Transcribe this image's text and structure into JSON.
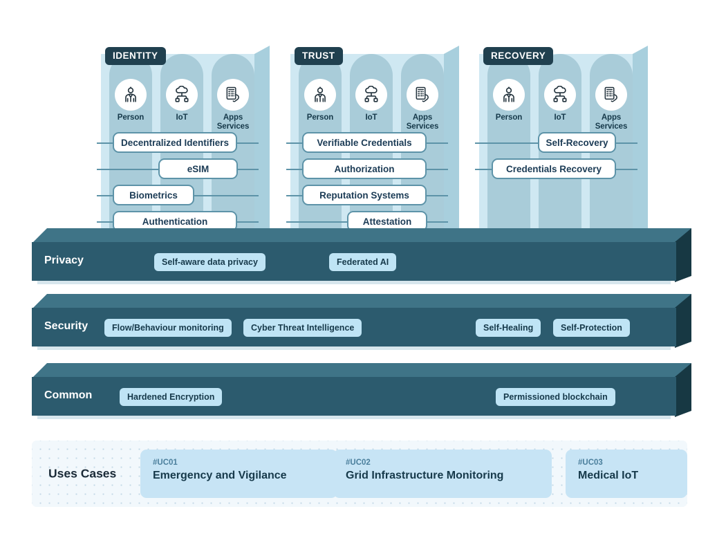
{
  "diagram": {
    "pillars": [
      {
        "title": "IDENTITY",
        "actors": [
          {
            "icon": "person-icon",
            "label": "Person"
          },
          {
            "icon": "iot-cloud-icon",
            "label": "IoT"
          },
          {
            "icon": "apps-services-icon",
            "label": "Apps\nServices"
          }
        ],
        "capabilities": [
          "Decentralized Identifiers",
          "eSIM",
          "Biometrics",
          "Authentication"
        ]
      },
      {
        "title": "TRUST",
        "actors": [
          {
            "icon": "person-icon",
            "label": "Person"
          },
          {
            "icon": "iot-cloud-icon",
            "label": "IoT"
          },
          {
            "icon": "apps-services-icon",
            "label": "Apps\nServices"
          }
        ],
        "capabilities": [
          "Verifiable Credentials",
          "Authorization",
          "Reputation Systems",
          "Attestation"
        ]
      },
      {
        "title": "RECOVERY",
        "actors": [
          {
            "icon": "person-icon",
            "label": "Person"
          },
          {
            "icon": "iot-cloud-icon",
            "label": "IoT"
          },
          {
            "icon": "apps-services-icon",
            "label": "Apps\nServices"
          }
        ],
        "capabilities": [
          "Self-Recovery",
          "Credentials Recovery"
        ]
      }
    ],
    "layers": [
      {
        "label": "Privacy",
        "tags": [
          "Self-aware data privacy",
          "Federated AI"
        ]
      },
      {
        "label": "Security",
        "tags": [
          "Flow/Behaviour monitoring",
          "Cyber Threat Intelligence",
          "Self-Healing",
          "Self-Protection"
        ]
      },
      {
        "label": "Common",
        "tags": [
          "Hardened Encryption",
          "Permissioned blockchain"
        ]
      }
    ],
    "use_cases": {
      "title": "Uses Cases",
      "items": [
        {
          "id": "#UC01",
          "name": "Emergency and Vigilance"
        },
        {
          "id": "#UC02",
          "name": "Grid Infrastructure Monitoring"
        },
        {
          "id": "#UC03",
          "name": "Medical IoT"
        }
      ]
    },
    "colors": {
      "pillar_face": "#cfe8f2",
      "pillar_column": "#a9ccd9",
      "pillar_side": "#a8cfdd",
      "title_tag": "#20404f",
      "slab_top": "#3f7487",
      "slab_face": "#2c5b6e",
      "slab_side": "#173843",
      "tag_bg": "#bfe4f5",
      "text_dark": "#16394a",
      "usecase_bg": "#f2f8fc",
      "usecase_card": "#c7e4f5"
    }
  }
}
